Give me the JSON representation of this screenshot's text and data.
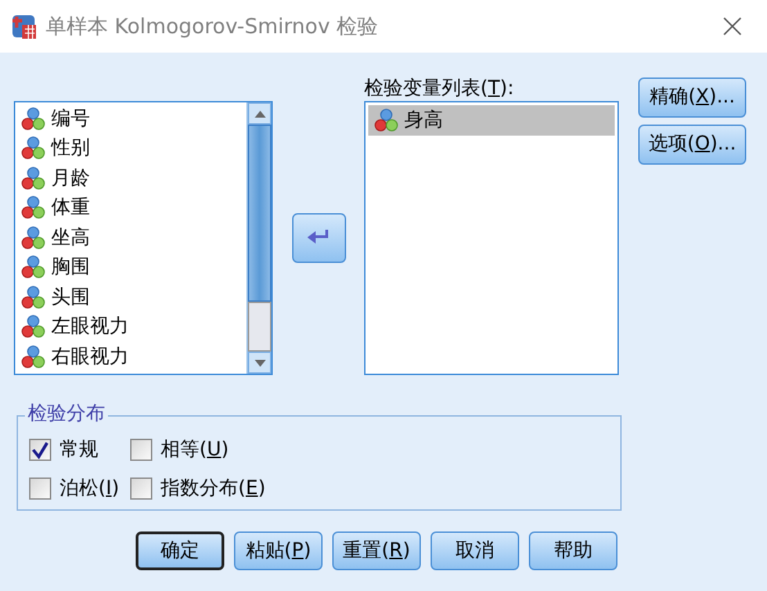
{
  "window": {
    "title": "单样本 Kolmogorov-Smirnov 检验"
  },
  "source_list": {
    "items": [
      {
        "label": "编号",
        "selected": false
      },
      {
        "label": "性别",
        "selected": false
      },
      {
        "label": "月龄",
        "selected": false
      },
      {
        "label": "体重",
        "selected": false
      },
      {
        "label": "坐高",
        "selected": false
      },
      {
        "label": "胸围",
        "selected": false
      },
      {
        "label": "头围",
        "selected": false
      },
      {
        "label": "左眼视力",
        "selected": false
      },
      {
        "label": "右眼视力",
        "selected": false
      }
    ]
  },
  "test_list": {
    "label": {
      "before": "检验变量列表(",
      "key": "T",
      "after": "):"
    },
    "items": [
      {
        "label": "身高",
        "selected": true
      }
    ]
  },
  "side_buttons": [
    {
      "before": "精确(",
      "key": "X",
      "after": ")..."
    },
    {
      "before": "选项(",
      "key": "O",
      "after": ")..."
    }
  ],
  "distribution": {
    "title": "检验分布",
    "options": [
      {
        "before": "常规",
        "checked": true
      },
      {
        "before": "相等(",
        "key": "U",
        "after": ")",
        "checked": false
      },
      {
        "before": "泊松(",
        "key": "I",
        "after": ")",
        "checked": false
      },
      {
        "before": "指数分布(",
        "key": "E",
        "after": ")",
        "checked": false
      }
    ]
  },
  "buttons": [
    {
      "before": "确定",
      "default": true
    },
    {
      "before": "粘贴(",
      "key": "P",
      "after": ")",
      "default": false
    },
    {
      "before": "重置(",
      "key": "R",
      "after": ")",
      "default": false
    },
    {
      "before": "取消",
      "default": false
    },
    {
      "before": "帮助",
      "default": false
    }
  ]
}
